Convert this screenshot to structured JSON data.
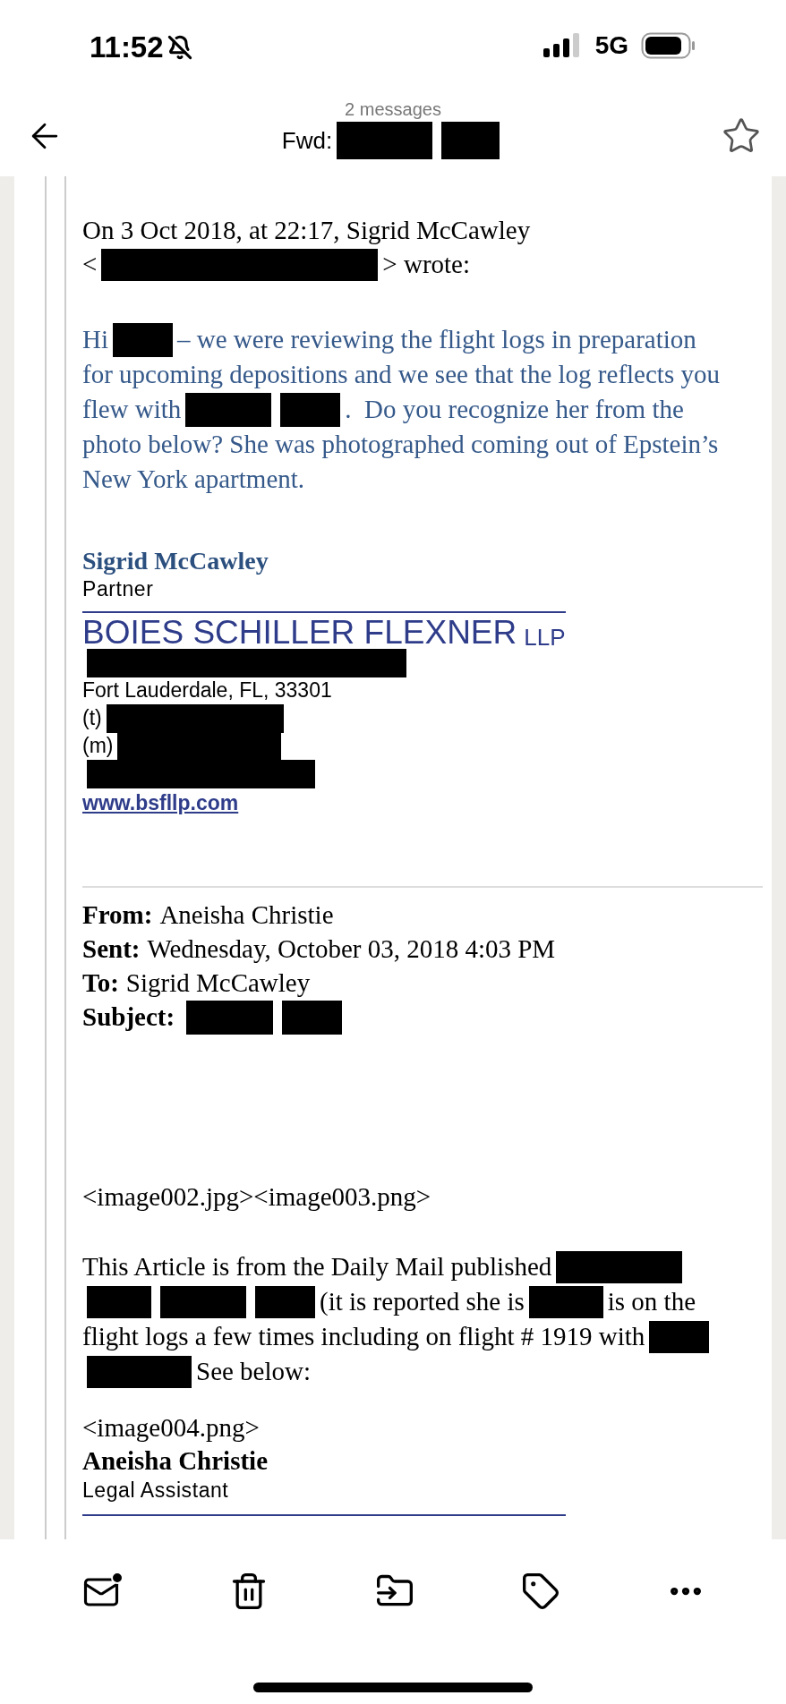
{
  "status_bar": {
    "time": "11:52",
    "network": "5G"
  },
  "header": {
    "count": "2 messages",
    "subject": [
      {
        "kind": "text",
        "text": "Fwd:"
      },
      {
        "kind": "redaction"
      },
      {
        "kind": "redaction"
      }
    ]
  },
  "message": {
    "quote_header": [
      [
        {
          "kind": "text",
          "text": "On 3 Oct 2018, at 22:17, Sigrid McCawley"
        }
      ],
      [
        {
          "kind": "text",
          "text": "<"
        },
        {
          "kind": "redaction"
        },
        {
          "kind": "text",
          "text": "> wrote:"
        }
      ]
    ],
    "body": [
      [
        {
          "kind": "text",
          "text": "Hi"
        },
        {
          "kind": "redaction"
        },
        {
          "kind": "text",
          "text": "– we were reviewing the flight logs in preparation"
        }
      ],
      [
        {
          "kind": "text",
          "text": "for upcoming depositions and we see that the log reflects you"
        }
      ],
      [
        {
          "kind": "text",
          "text": "flew with"
        },
        {
          "kind": "redaction"
        },
        {
          "kind": "redaction"
        },
        {
          "kind": "text",
          "text": ".  Do you recognize her from the"
        }
      ],
      [
        {
          "kind": "text",
          "text": "photo below? She was photographed coming out of Epstein’s"
        }
      ],
      [
        {
          "kind": "text",
          "text": "New York apartment."
        }
      ]
    ],
    "signature": {
      "name": "Sigrid McCawley",
      "title": "Partner",
      "firm": "BOIES SCHILLER FLEXNER",
      "firm_suffix": "LLP",
      "address_lines": [
        [
          {
            "kind": "redaction"
          }
        ],
        [
          {
            "kind": "text",
            "text": "Fort Lauderdale, FL, 33301"
          }
        ],
        [
          {
            "kind": "text",
            "text": "(t)"
          },
          {
            "kind": "redaction"
          }
        ],
        [
          {
            "kind": "text",
            "text": "(m)"
          },
          {
            "kind": "redaction"
          }
        ],
        [
          {
            "kind": "redaction"
          }
        ]
      ],
      "website": "www.bsfllp.com"
    },
    "forward_header": [
      {
        "label": "From:",
        "value": [
          {
            "kind": "text",
            "text": "Aneisha Christie"
          }
        ]
      },
      {
        "label": "Sent:",
        "value": [
          {
            "kind": "text",
            "text": "Wednesday, October 03, 2018 4:03 PM"
          }
        ]
      },
      {
        "label": "To:",
        "value": [
          {
            "kind": "text",
            "text": "Sigrid McCawley"
          }
        ]
      },
      {
        "label": "Subject:",
        "value": [
          {
            "kind": "redaction"
          },
          {
            "kind": "redaction"
          }
        ]
      }
    ],
    "attachments_line": "<image002.jpg><image003.png>",
    "article": [
      [
        {
          "kind": "text",
          "text": "This Article is from the Daily Mail published"
        },
        {
          "kind": "redaction"
        }
      ],
      [
        {
          "kind": "redaction"
        },
        {
          "kind": "redaction"
        },
        {
          "kind": "redaction"
        },
        {
          "kind": "text",
          "text": "(it is reported she is"
        },
        {
          "kind": "redaction"
        },
        {
          "kind": "text",
          "text": "is on the"
        }
      ],
      [
        {
          "kind": "text",
          "text": "flight logs a few times including on flight # 1919 with"
        },
        {
          "kind": "redaction"
        }
      ],
      [
        {
          "kind": "redaction"
        },
        {
          "kind": "text",
          "text": "See below:"
        }
      ]
    ],
    "image_line": "<image004.png>",
    "sender": {
      "name": "Aneisha Christie",
      "title": "Legal Assistant"
    }
  }
}
